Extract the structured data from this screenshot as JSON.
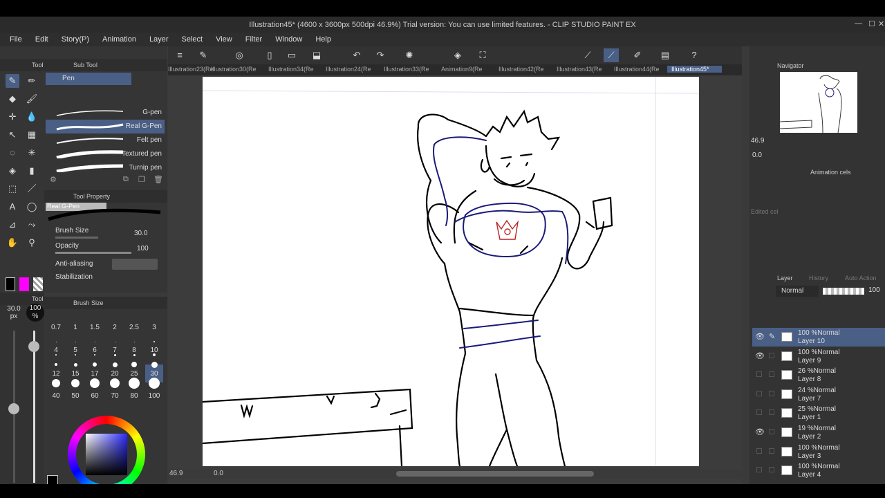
{
  "window": {
    "title": "Illustration45* (4600 x 3600px 500dpi 46.9%)  Trial version: You can use limited features. - CLIP STUDIO PAINT EX"
  },
  "menu": [
    "File",
    "Edit",
    "Story(P)",
    "Animation",
    "Layer",
    "Select",
    "View",
    "Filter",
    "Window",
    "Help"
  ],
  "tool_panel": {
    "title": "Tool",
    "sub_tool_title": "Sub Tool",
    "group": "Pen",
    "sub_tools": [
      "G-pen",
      "Real G-Pen",
      "Felt pen",
      "Textured pen",
      "Turnip pen"
    ],
    "selected": "Real G-Pen"
  },
  "tool_property": {
    "title": "Tool Property",
    "tool_name": "Real G-Pen",
    "brush_size_label": "Brush Size",
    "brush_size": "30.0",
    "opacity_label": "Opacity",
    "opacity": "100",
    "antialias_label": "Anti-aliasing",
    "stabilization_label": "Stabilization"
  },
  "brush_size_panel": {
    "title": "Brush Size",
    "current_size": "30.0",
    "unit": "px",
    "opacity_value": "100",
    "opacity_unit": "%",
    "sizes": [
      "0.7",
      "1",
      "1.5",
      "2",
      "2.5",
      "3",
      "4",
      "5",
      "6",
      "7",
      "8",
      "10",
      "12",
      "15",
      "17",
      "20",
      "25",
      "30",
      "40",
      "50",
      "60",
      "70",
      "80",
      "100"
    ],
    "selected": "30"
  },
  "tabs": [
    "Illustration23(Re",
    "Illustration30(Re",
    "Illustration34(Re",
    "Illustration24(Re",
    "Illustration33(Re",
    "Animation9(Re",
    "Illustration42(Re",
    "Illustration43(Re",
    "Illustration44(Re",
    "Illustration45*"
  ],
  "status": {
    "zoom": "46.9",
    "angle": "0.0"
  },
  "navigator": {
    "title": "Navigator",
    "zoom": "46.9",
    "angle": "0.0"
  },
  "animation_cels": {
    "title": "Animation cels",
    "edited_cel": "Edited cel"
  },
  "layer_panel": {
    "title": "Layer",
    "history_tab": "History",
    "auto_action_tab": "Auto Action",
    "blend_mode": "Normal",
    "opacity": "100",
    "layers": [
      {
        "opacity": "100 %Normal",
        "name": "Layer 10",
        "visible": true,
        "selected": true
      },
      {
        "opacity": "100 %Normal",
        "name": "Layer 9",
        "visible": true,
        "selected": false
      },
      {
        "opacity": "26 %Normal",
        "name": "Layer 8",
        "visible": false,
        "selected": false
      },
      {
        "opacity": "24 %Normal",
        "name": "Layer 7",
        "visible": false,
        "selected": false
      },
      {
        "opacity": "25 %Normal",
        "name": "Layer 1",
        "visible": false,
        "selected": false
      },
      {
        "opacity": "19 %Normal",
        "name": "Layer 2",
        "visible": true,
        "selected": false
      },
      {
        "opacity": "100 %Normal",
        "name": "Layer 3",
        "visible": false,
        "selected": false
      },
      {
        "opacity": "100 %Normal",
        "name": "Layer 4",
        "visible": false,
        "selected": false
      }
    ]
  },
  "colors": {
    "main": "#000000",
    "sub": "#ff00ff",
    "accent": "#4a5f86"
  },
  "icons": [
    "pen-icon",
    "eraser-icon",
    "move-icon",
    "lasso-icon",
    "fill-icon",
    "text-icon",
    "hand-icon",
    "eyedropper-icon",
    "undo-icon",
    "redo-icon"
  ]
}
